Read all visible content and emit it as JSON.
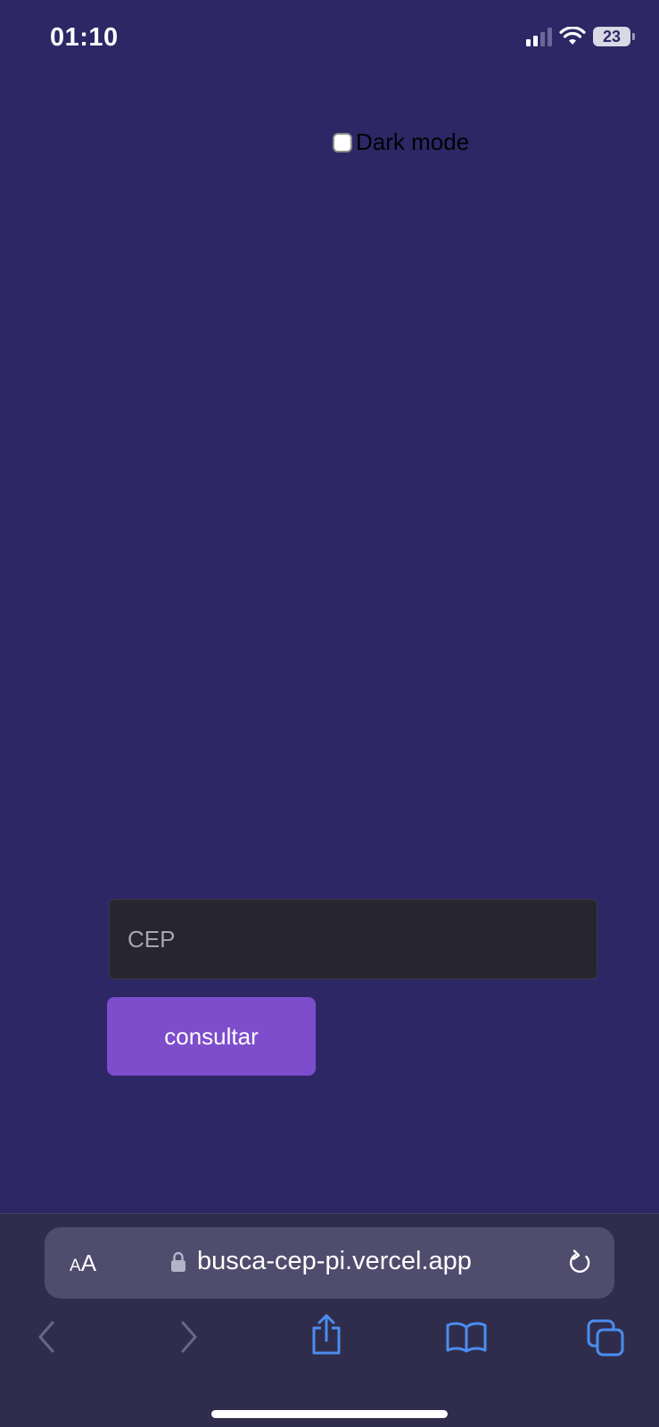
{
  "status_bar": {
    "time": "01:10",
    "battery_level": "23",
    "icons": [
      "cellular-signal-icon",
      "wifi-icon",
      "battery-icon"
    ]
  },
  "page": {
    "dark_mode_label": "Dark mode",
    "dark_mode_checked": false,
    "cep_placeholder": "CEP",
    "cep_value": "",
    "consultar_label": "consultar",
    "colors": {
      "background": "#2d2766",
      "input_background": "#27252f",
      "button_background": "#7d4dcc"
    }
  },
  "browser": {
    "text_size_label_small": "A",
    "text_size_label_large": "A",
    "url": "busca-cep-pi.vercel.app",
    "accent_color": "#4a8df0",
    "toolbar_icons": [
      "back-icon",
      "forward-icon",
      "share-icon",
      "bookmarks-icon",
      "tabs-icon"
    ]
  }
}
